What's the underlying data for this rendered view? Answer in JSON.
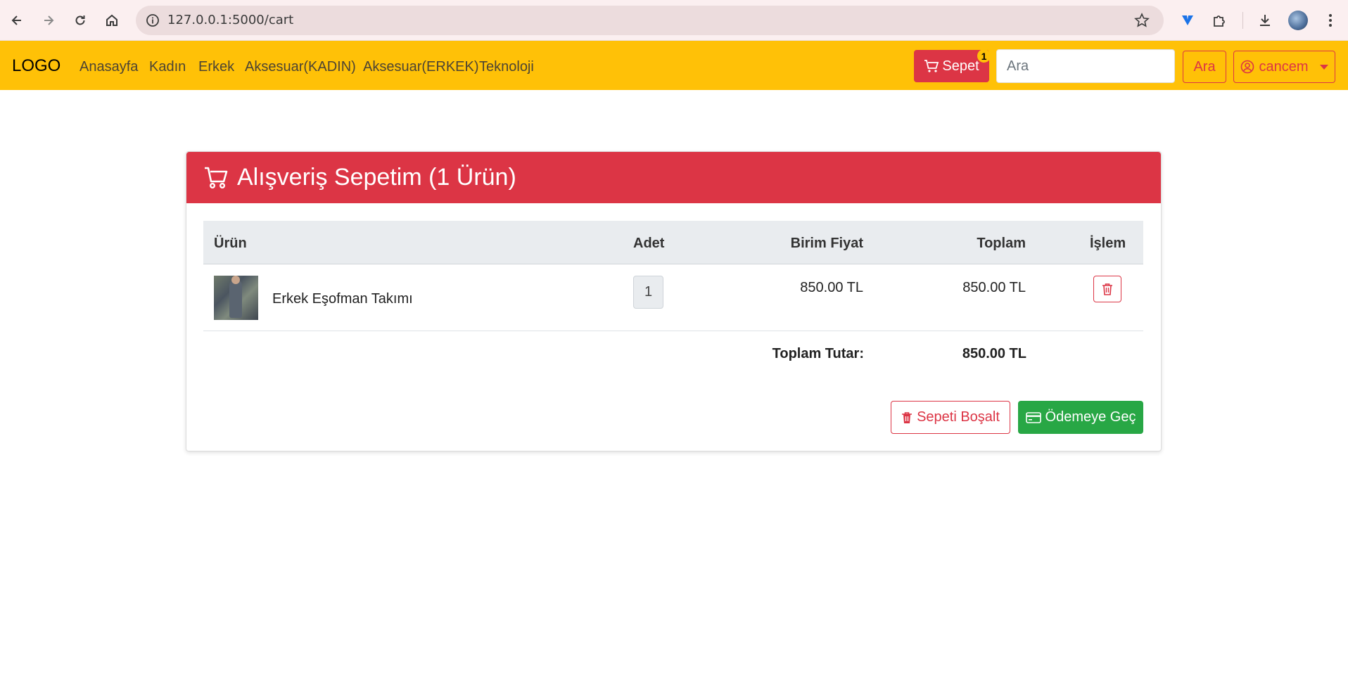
{
  "browser": {
    "url": "127.0.0.1:5000/cart",
    "icons": [
      "back-icon",
      "forward-icon",
      "reload-icon",
      "home-icon",
      "info-icon",
      "star-icon",
      "extension-shield-icon",
      "puzzle-icon",
      "download-icon",
      "profile-avatar",
      "menu-dots-icon"
    ]
  },
  "navbar": {
    "brand": "LOGO",
    "links": [
      "Anasayfa",
      "Kadın",
      "Erkek",
      "Aksesuar(KADIN)",
      "Aksesuar(ERKEK)",
      "Teknoloji"
    ],
    "cart_label": "Sepet",
    "cart_count": "1",
    "search_placeholder": "Ara",
    "search_button": "Ara",
    "user_label": "cancem"
  },
  "cart": {
    "title": "Alışveriş Sepetim (1 Ürün)",
    "columns": {
      "product": "Ürün",
      "quantity": "Adet",
      "unit_price": "Birim Fiyat",
      "total": "Toplam",
      "action": "İşlem"
    },
    "items": [
      {
        "name": "Erkek Eşofman Takımı",
        "quantity": "1",
        "unit_price": "850.00 TL",
        "total": "850.00 TL"
      }
    ],
    "grand_total_label": "Toplam Tutar:",
    "grand_total": "850.00 TL",
    "empty_button": "Sepeti Boşalt",
    "checkout_button": "Ödemeye Geç"
  },
  "colors": {
    "navbar": "#ffc107",
    "danger": "#dc3545",
    "success": "#28a745"
  }
}
